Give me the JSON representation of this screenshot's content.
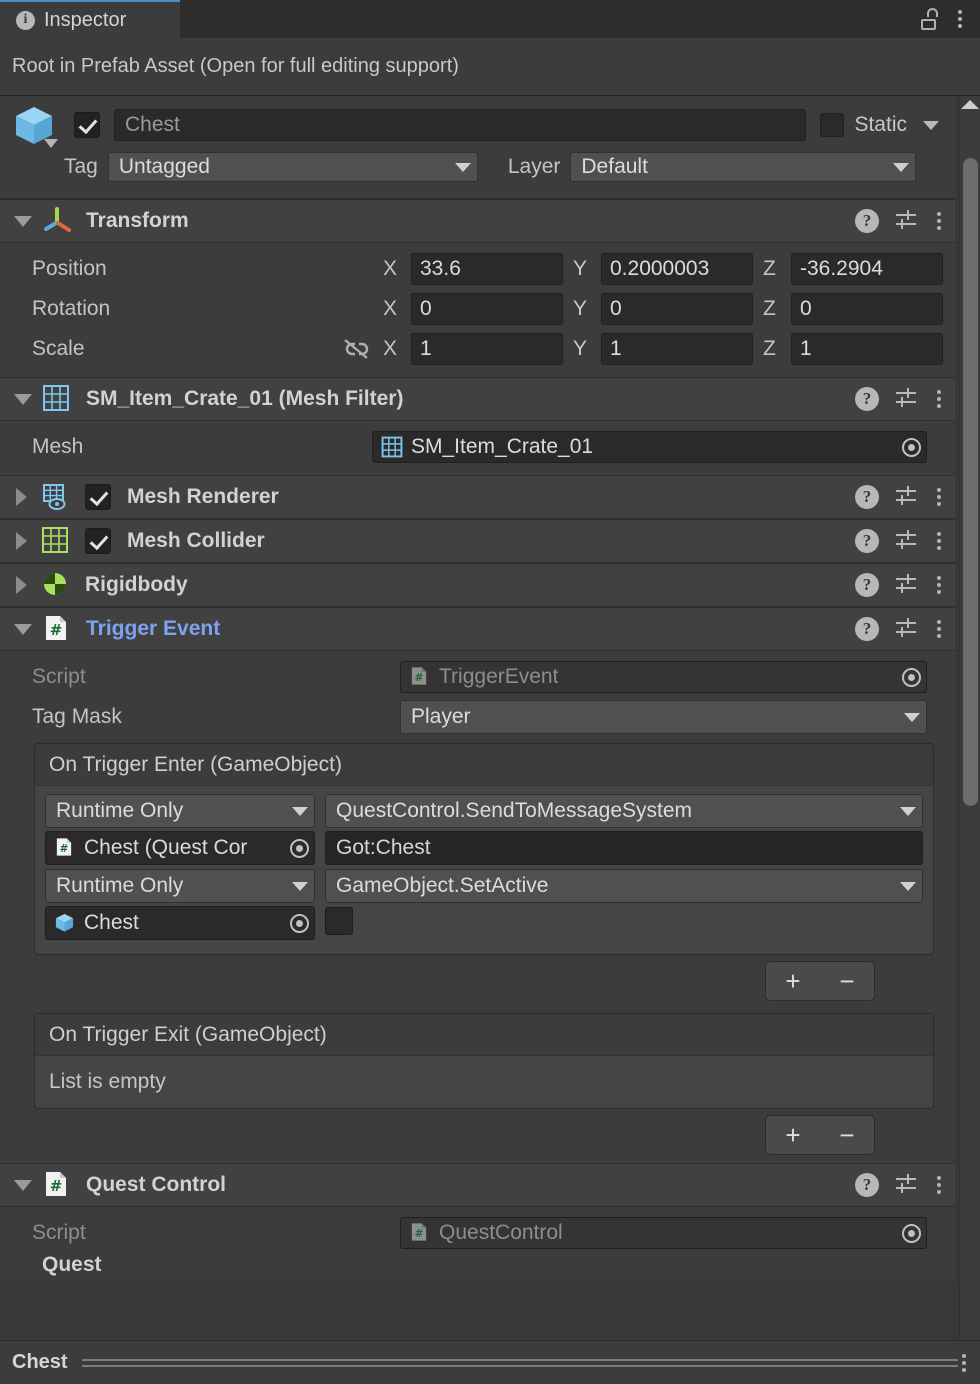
{
  "window": {
    "tab_label": "Inspector",
    "tab_icon": "info-icon",
    "lock_icon": "unlocked-padlock-icon",
    "menu_icon": "kebab-menu-icon",
    "prefab_banner": "Root in Prefab Asset (Open for full editing support)"
  },
  "gameobject": {
    "icon": "prefab-cube-icon",
    "enabled": true,
    "name": "Chest",
    "static_label": "Static",
    "static_checked": false,
    "tag_label": "Tag",
    "tag_value": "Untagged",
    "layer_label": "Layer",
    "layer_value": "Default"
  },
  "component_actions": {
    "help": "?",
    "help_name": "help-icon",
    "preset": "preset-icon",
    "menu": "kebab-menu-icon"
  },
  "components": [
    {
      "title": "Transform",
      "icon": "transform-gizmo-icon",
      "expanded": true,
      "has_toggle": false,
      "rows": [
        {
          "label": "Position",
          "x": "33.6",
          "y": "0.2000003",
          "z": "-36.2904"
        },
        {
          "label": "Rotation",
          "x": "0",
          "y": "0",
          "z": "0"
        },
        {
          "label": "Scale",
          "x": "1",
          "y": "1",
          "z": "1",
          "link_icon": "broken-link-icon"
        }
      ],
      "axis_labels": [
        "X",
        "Y",
        "Z"
      ]
    },
    {
      "title": "SM_Item_Crate_01 (Mesh Filter)",
      "icon": "mesh-filter-icon",
      "expanded": true,
      "has_toggle": false,
      "mesh_label": "Mesh",
      "mesh_value": "SM_Item_Crate_01"
    },
    {
      "title": "Mesh Renderer",
      "icon": "mesh-renderer-icon",
      "expanded": false,
      "has_toggle": true,
      "enabled": true
    },
    {
      "title": "Mesh Collider",
      "icon": "mesh-collider-icon",
      "expanded": false,
      "has_toggle": true,
      "enabled": true
    },
    {
      "title": "Rigidbody",
      "icon": "rigidbody-icon",
      "expanded": false,
      "has_toggle": false
    }
  ],
  "trigger_event": {
    "title": "Trigger Event",
    "icon": "cs-script-icon",
    "script_label": "Script",
    "script_value": "TriggerEvent",
    "tag_mask_label": "Tag Mask",
    "tag_mask_value": "Player",
    "on_enter": {
      "title": "On Trigger Enter (GameObject)",
      "entries": [
        {
          "mode": "Runtime Only",
          "target": "Chest (Quest Cor",
          "target_icon": "cs-script-icon",
          "function": "QuestControl.SendToMessageSystem",
          "arg_type": "string",
          "arg_value": "Got:Chest"
        },
        {
          "mode": "Runtime Only",
          "target": "Chest",
          "target_icon": "prefab-cube-icon",
          "function": "GameObject.SetActive",
          "arg_type": "bool",
          "arg_value": false
        }
      ],
      "add_label": "+",
      "remove_label": "−"
    },
    "on_exit": {
      "title": "On Trigger Exit (GameObject)",
      "empty_text": "List is empty",
      "add_label": "+",
      "remove_label": "−"
    }
  },
  "quest_control": {
    "title": "Quest Control",
    "icon": "cs-script-icon",
    "script_label": "Script",
    "script_value": "QuestControl",
    "cut_off_row": "Quest"
  },
  "footer": {
    "name": "Chest",
    "menu_icon": "kebab-menu-icon"
  },
  "colors": {
    "background": "#383838",
    "panel": "#3c3c3c",
    "header": "#414141",
    "accent_tab": "#4a8ec2",
    "script_title": "#7ea2f0",
    "prefab_blue": "#8fcbf0",
    "collider_green": "#a8e063"
  }
}
